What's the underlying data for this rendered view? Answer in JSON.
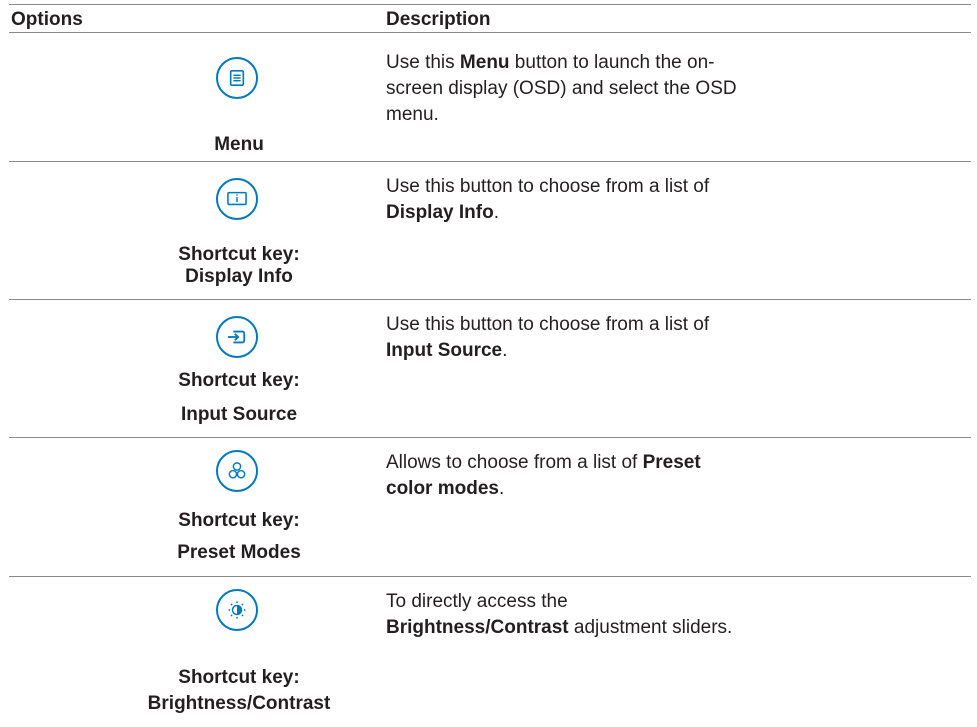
{
  "header": {
    "options": "Options",
    "description": "Description"
  },
  "rows": [
    {
      "icon": "menu-icon",
      "label1": "Menu",
      "label2": "",
      "desc": {
        "p1": "Use this ",
        "b1": "Menu",
        "p2": " button to launch the on-screen display (OSD) and select the OSD menu.",
        "b2": "",
        "p3": ""
      }
    },
    {
      "icon": "display-info-icon",
      "label1": "Shortcut key:",
      "label2": "Display Info",
      "desc": {
        "p1": "Use this button to choose from a list of ",
        "b1": "Display Info",
        "p2": ".",
        "b2": "",
        "p3": ""
      }
    },
    {
      "icon": "input-source-icon",
      "label1": "Shortcut key:",
      "label2": "Input Source",
      "desc": {
        "p1": "Use this button to choose from a list of ",
        "b1": "Input Source",
        "p2": ".",
        "b2": "",
        "p3": ""
      }
    },
    {
      "icon": "preset-modes-icon",
      "label1": "Shortcut key:",
      "label2": "Preset Modes",
      "desc": {
        "p1": "Allows to choose from a list of ",
        "b1": "Preset color modes",
        "p2": ".",
        "b2": "",
        "p3": ""
      }
    },
    {
      "icon": "brightness-contrast-icon",
      "label1": "Shortcut key:",
      "label2": "Brightness/Contrast",
      "desc": {
        "p1": "To directly access the ",
        "b1": "Brightness/Contrast",
        "p2": " adjustment sliders.",
        "b2": "",
        "p3": ""
      }
    }
  ],
  "colors": {
    "accent": "#0079bf",
    "rule": "#8a8a8a",
    "text": "#231f20"
  }
}
